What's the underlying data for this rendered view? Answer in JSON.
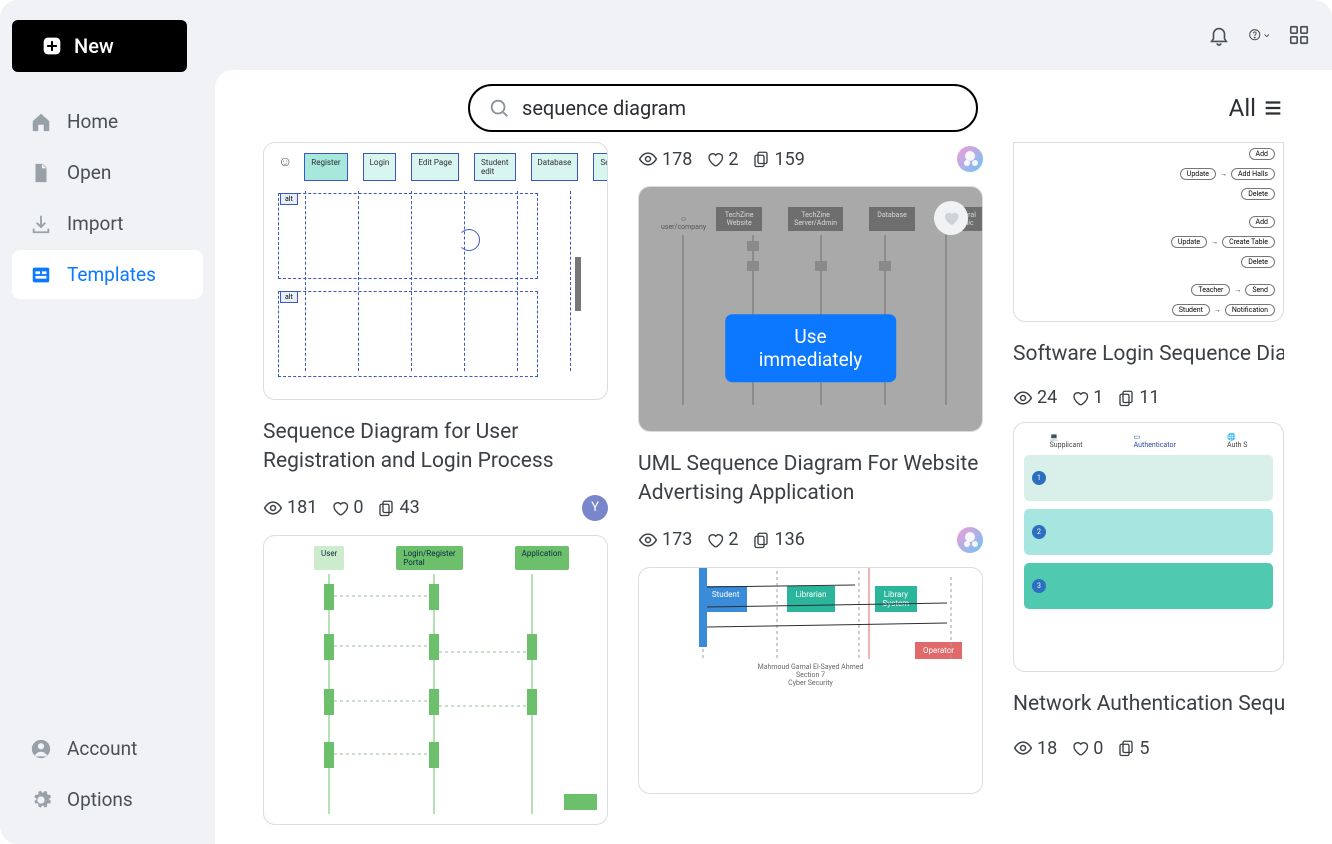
{
  "sidebar": {
    "new_label": "New",
    "items": [
      {
        "label": "Home"
      },
      {
        "label": "Open"
      },
      {
        "label": "Import"
      },
      {
        "label": "Templates"
      }
    ],
    "bottom": [
      {
        "label": "Account"
      },
      {
        "label": "Options"
      }
    ]
  },
  "search": {
    "value": "sequence diagram"
  },
  "filter_label": "All",
  "overlay_button": "Use immediately",
  "cards": {
    "top_stats_c2": {
      "views": "178",
      "likes": "2",
      "copies": "159"
    },
    "c1a": {
      "title": "Sequence Diagram for User Registration and Login Process",
      "views": "181",
      "likes": "0",
      "copies": "43",
      "avatar": "Y"
    },
    "c2a": {
      "title": "UML Sequence Diagram For Website Advertising Application",
      "views": "173",
      "likes": "2",
      "copies": "136"
    },
    "c3a": {
      "title": "Software Login Sequence Diagram",
      "views": "24",
      "likes": "1",
      "copies": "11"
    },
    "c3b": {
      "title": "Network Authentication Sequence Diagram",
      "views": "18",
      "likes": "0",
      "copies": "5"
    }
  }
}
